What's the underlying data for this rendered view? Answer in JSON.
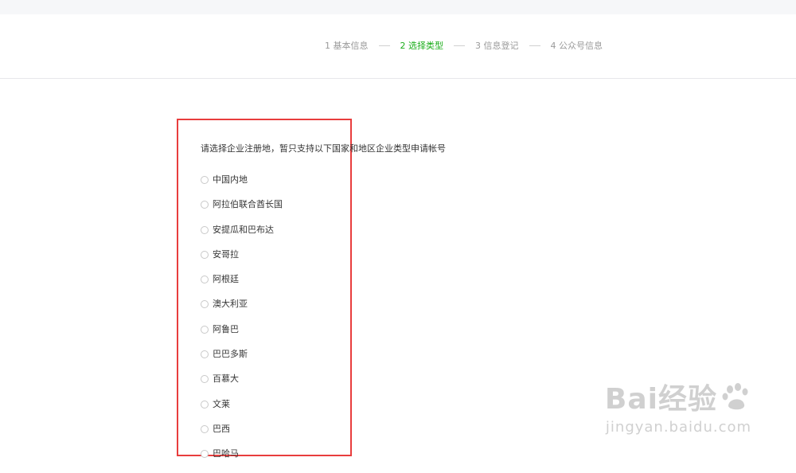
{
  "steps": [
    {
      "label": "1 基本信息",
      "active": false
    },
    {
      "label": "2 选择类型",
      "active": true
    },
    {
      "label": "3 信息登记",
      "active": false
    },
    {
      "label": "4 公众号信息",
      "active": false
    }
  ],
  "instruction": "请选择企业注册地，暂只支持以下国家和地区企业类型申请帐号",
  "options": [
    "中国内地",
    "阿拉伯联合酋长国",
    "安提瓜和巴布达",
    "安哥拉",
    "阿根廷",
    "澳大利亚",
    "阿鲁巴",
    "巴巴多斯",
    "百慕大",
    "文莱",
    "巴西",
    "巴哈马"
  ],
  "watermark": {
    "brand": "Bai经验",
    "url": "jingyan.baidu.com"
  }
}
